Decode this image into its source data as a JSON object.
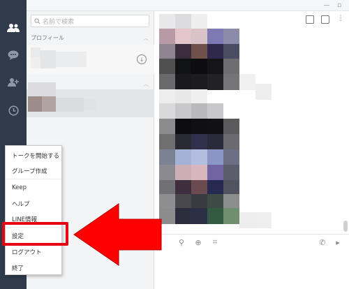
{
  "search": {
    "placeholder": "名前で検索"
  },
  "sections": {
    "profile": "プロフィール"
  },
  "menu": {
    "items": [
      "トークを開始する",
      "グループ作成",
      "Keep",
      "ヘルプ",
      "LINE情報",
      "設定",
      "ログアウト",
      "終了"
    ],
    "selected": "設定"
  },
  "sidebar": {
    "icons": [
      "friends-icon",
      "chat-icon",
      "add-friend-icon",
      "history-icon",
      "settings-icon"
    ]
  },
  "colors": {
    "sidebar": "#2f3a4a",
    "highlight": "#e60012",
    "arrow": "#ff0000"
  }
}
